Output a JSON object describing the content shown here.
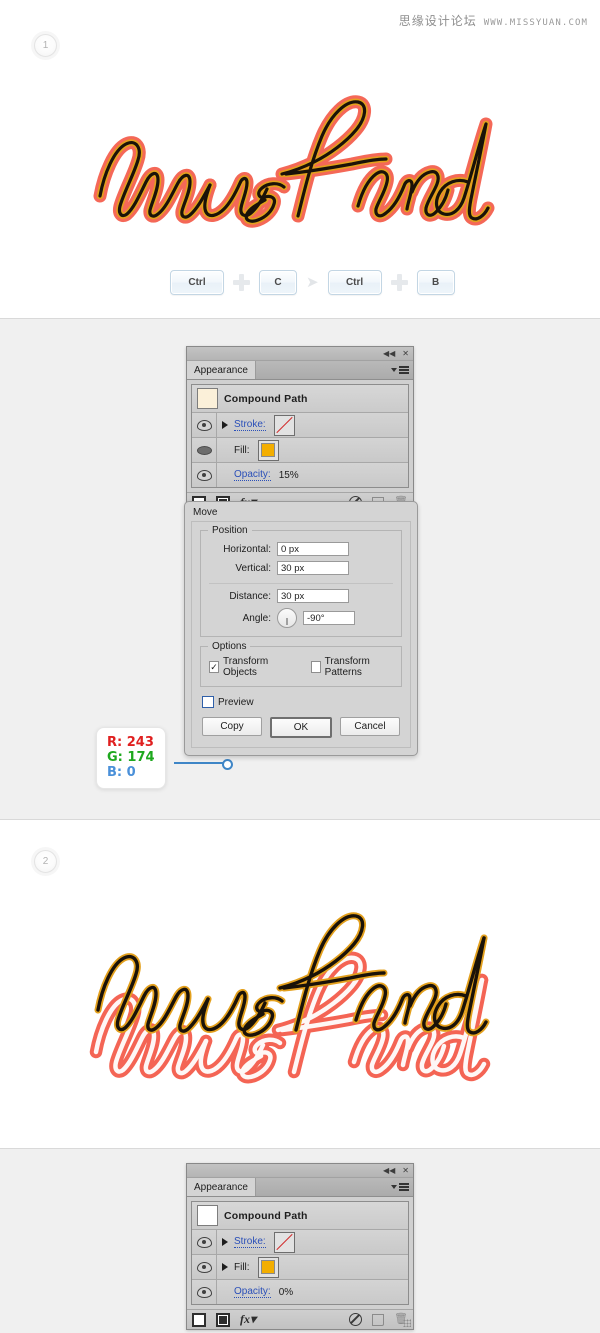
{
  "watermark": {
    "cn": "思缘设计论坛",
    "url": "WWW.MISSYUAN.COM"
  },
  "sections": {
    "step1": {
      "badge": "1",
      "artwork_word": "mustard",
      "shortcuts": [
        {
          "type": "key",
          "label": "Ctrl",
          "wide": true
        },
        {
          "type": "plus",
          "label": "plus-icon"
        },
        {
          "type": "key",
          "label": "C",
          "wide": false
        },
        {
          "type": "arrow",
          "label": "then-arrow-icon"
        },
        {
          "type": "key",
          "label": "Ctrl",
          "wide": true
        },
        {
          "type": "plus",
          "label": "plus-icon"
        },
        {
          "type": "key",
          "label": "B",
          "wide": false
        }
      ]
    },
    "step2": {
      "badge": "2",
      "artwork_word": "mustard"
    }
  },
  "appearance_panel_top": {
    "tab_label": "Appearance",
    "collapse_icon": "◀◀",
    "close_icon": "✕",
    "object_title": "Compound Path",
    "thumbnail_color": "#fbf0d9",
    "rows": [
      {
        "label": "Stroke:",
        "value": "",
        "swatch": "none",
        "eye": "visible",
        "triangle": true
      },
      {
        "label": "Fill:",
        "value": "",
        "swatch": "#f3ae00",
        "eye": "selected",
        "triangle": false
      },
      {
        "label": "Opacity:",
        "value": "15%",
        "swatch": "",
        "eye": "visible",
        "triangle": false
      }
    ],
    "footer_icons": [
      "add-new-stroke-icon",
      "add-new-fill-icon",
      "fx-icon",
      "clear-appearance-icon",
      "duplicate-item-icon",
      "delete-item-icon",
      "resize-grip-icon"
    ]
  },
  "appearance_panel_bottom": {
    "tab_label": "Appearance",
    "collapse_icon": "◀◀",
    "close_icon": "✕",
    "object_title": "Compound Path",
    "thumbnail_color": "#ffffff",
    "rows": [
      {
        "label": "Stroke:",
        "value": "",
        "swatch": "none",
        "eye": "visible",
        "triangle": true
      },
      {
        "label": "Fill:",
        "value": "",
        "swatch": "#f3ae00",
        "eye": "visible",
        "triangle": true
      },
      {
        "label": "Opacity:",
        "value": "0%",
        "swatch": "",
        "eye": "visible",
        "triangle": false
      }
    ],
    "footer_icons": [
      "add-new-stroke-icon",
      "add-new-fill-icon",
      "fx-icon",
      "clear-appearance-icon",
      "duplicate-item-icon",
      "delete-item-icon",
      "resize-grip-icon"
    ]
  },
  "rgb_callout": {
    "r_label": "R: 243",
    "g_label": "G: 174",
    "b_label": "B: 0",
    "r_color": "#e02020",
    "g_color": "#1ea81e",
    "b_color": "#4a90d9",
    "leader_color": "#3f86c7"
  },
  "move_dialog": {
    "title": "Move",
    "position_legend": "Position",
    "horizontal_label": "Horizontal:",
    "horizontal_value": "0 px",
    "vertical_label": "Vertical:",
    "vertical_value": "30 px",
    "distance_label": "Distance:",
    "distance_value": "30 px",
    "angle_label": "Angle:",
    "angle_value": "-90°",
    "options_legend": "Options",
    "transform_objects_label": "Transform Objects",
    "transform_objects_checked": "✓",
    "transform_patterns_label": "Transform Patterns",
    "transform_patterns_checked": "",
    "preview_label": "Preview",
    "preview_checked": "",
    "copy_button": "Copy",
    "ok_button": "OK",
    "cancel_button": "Cancel"
  }
}
